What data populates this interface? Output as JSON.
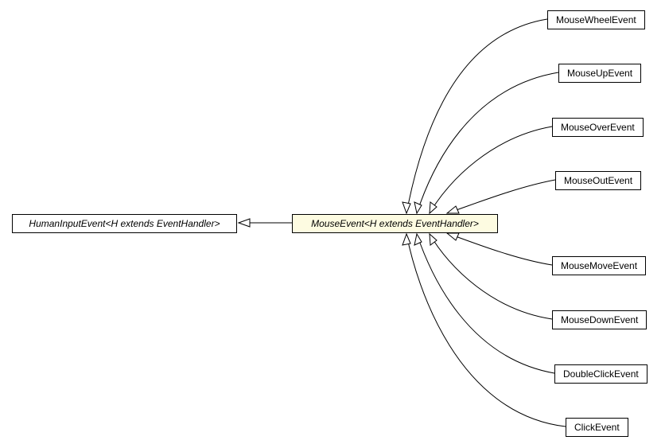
{
  "nodes": {
    "humanInput": "HumanInputEvent<H extends EventHandler>",
    "mouseEvent": "MouseEvent<H extends EventHandler>",
    "mouseWheel": "MouseWheelEvent",
    "mouseUp": "MouseUpEvent",
    "mouseOver": "MouseOverEvent",
    "mouseOut": "MouseOutEvent",
    "mouseMove": "MouseMoveEvent",
    "mouseDown": "MouseDownEvent",
    "doubleClick": "DoubleClickEvent",
    "click": "ClickEvent"
  }
}
